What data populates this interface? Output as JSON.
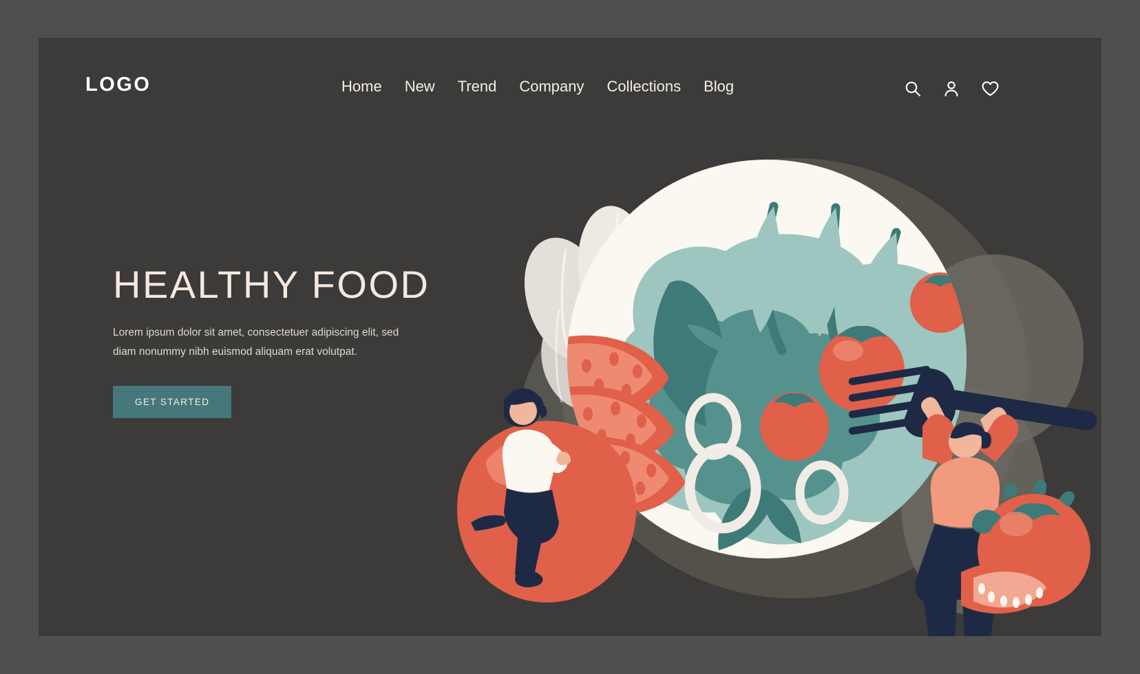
{
  "theme": {
    "outer_frame": "#4f4f4e",
    "panel_background": "#3c3b39",
    "accent_teal": "#46777a",
    "headline_color": "#f7e8dd",
    "nav_text_color": "#f2efe9",
    "tomato_red": "#e0604a",
    "salad_green": "#99c2bb",
    "salad_dark_green": "#3d7a78",
    "plate_white": "#fbf7f1",
    "navy": "#1e2a45"
  },
  "header": {
    "logo": "LOGO",
    "nav": [
      {
        "label": "Home"
      },
      {
        "label": "New"
      },
      {
        "label": "Trend"
      },
      {
        "label": "Company"
      },
      {
        "label": "Collections"
      },
      {
        "label": "Blog"
      }
    ],
    "icons": [
      {
        "name": "search-icon",
        "title": "Search"
      },
      {
        "name": "user-icon",
        "title": "Account"
      },
      {
        "name": "heart-icon",
        "title": "Favorites"
      }
    ]
  },
  "hero": {
    "headline": "HEALTHY FOOD",
    "body": "Lorem ipsum dolor sit amet, consectetuer adipiscing elit, sed diam nonummy nibh euismod aliquam erat volutpat.",
    "cta_label": "GET STARTED"
  },
  "illustration": {
    "alt": "Flat illustration of a large plate of salad with tomatoes, arugula leaves, onion rings, garlic bulbs, a giant tomato, a whole tomato with a wedge, a woman sitting on a tomato and a man lifting a fork"
  }
}
